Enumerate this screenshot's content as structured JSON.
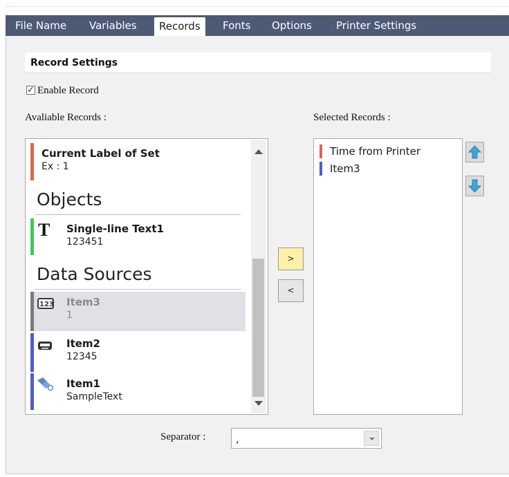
{
  "tabs": [
    {
      "label": "File Name",
      "active": false
    },
    {
      "label": "Variables",
      "active": false
    },
    {
      "label": "Records",
      "active": true
    },
    {
      "label": "Fonts",
      "active": false
    },
    {
      "label": "Options",
      "active": false
    },
    {
      "label": "Printer Settings",
      "active": false
    }
  ],
  "section": {
    "title": "Record Settings"
  },
  "enable_record": {
    "label": "Enable Record",
    "checked": true
  },
  "available": {
    "label": "Avaliable Records :",
    "items": [
      {
        "name": "Current Label of Set",
        "sub": "Ex : 1",
        "color": "#d9684f",
        "icon": null
      },
      {
        "name": "Single-line Text1",
        "sub": "123451",
        "color": "#3fc95c",
        "icon": "text-t-icon"
      },
      {
        "name": "Item3",
        "sub": "1",
        "color": "#7b7b7b",
        "icon": "counter-123-icon",
        "selected": true
      },
      {
        "name": "Item2",
        "sub": "12345",
        "color": "#4c5ec9",
        "icon": "keyboard-icon"
      },
      {
        "name": "Item1",
        "sub": "SampleText",
        "color": "#4c5ec9",
        "icon": "database-link-icon"
      }
    ],
    "groups": {
      "objects": "Objects",
      "data_sources": "Data Sources"
    }
  },
  "buttons": {
    "add": ">",
    "remove": "<"
  },
  "selected": {
    "label": "Selected Records :",
    "items": [
      {
        "name": "Time from Printer",
        "color": "#d9684f"
      },
      {
        "name": "Item3",
        "color": "#4c5ec9"
      }
    ]
  },
  "separator": {
    "label": "Separator :",
    "value": ","
  }
}
